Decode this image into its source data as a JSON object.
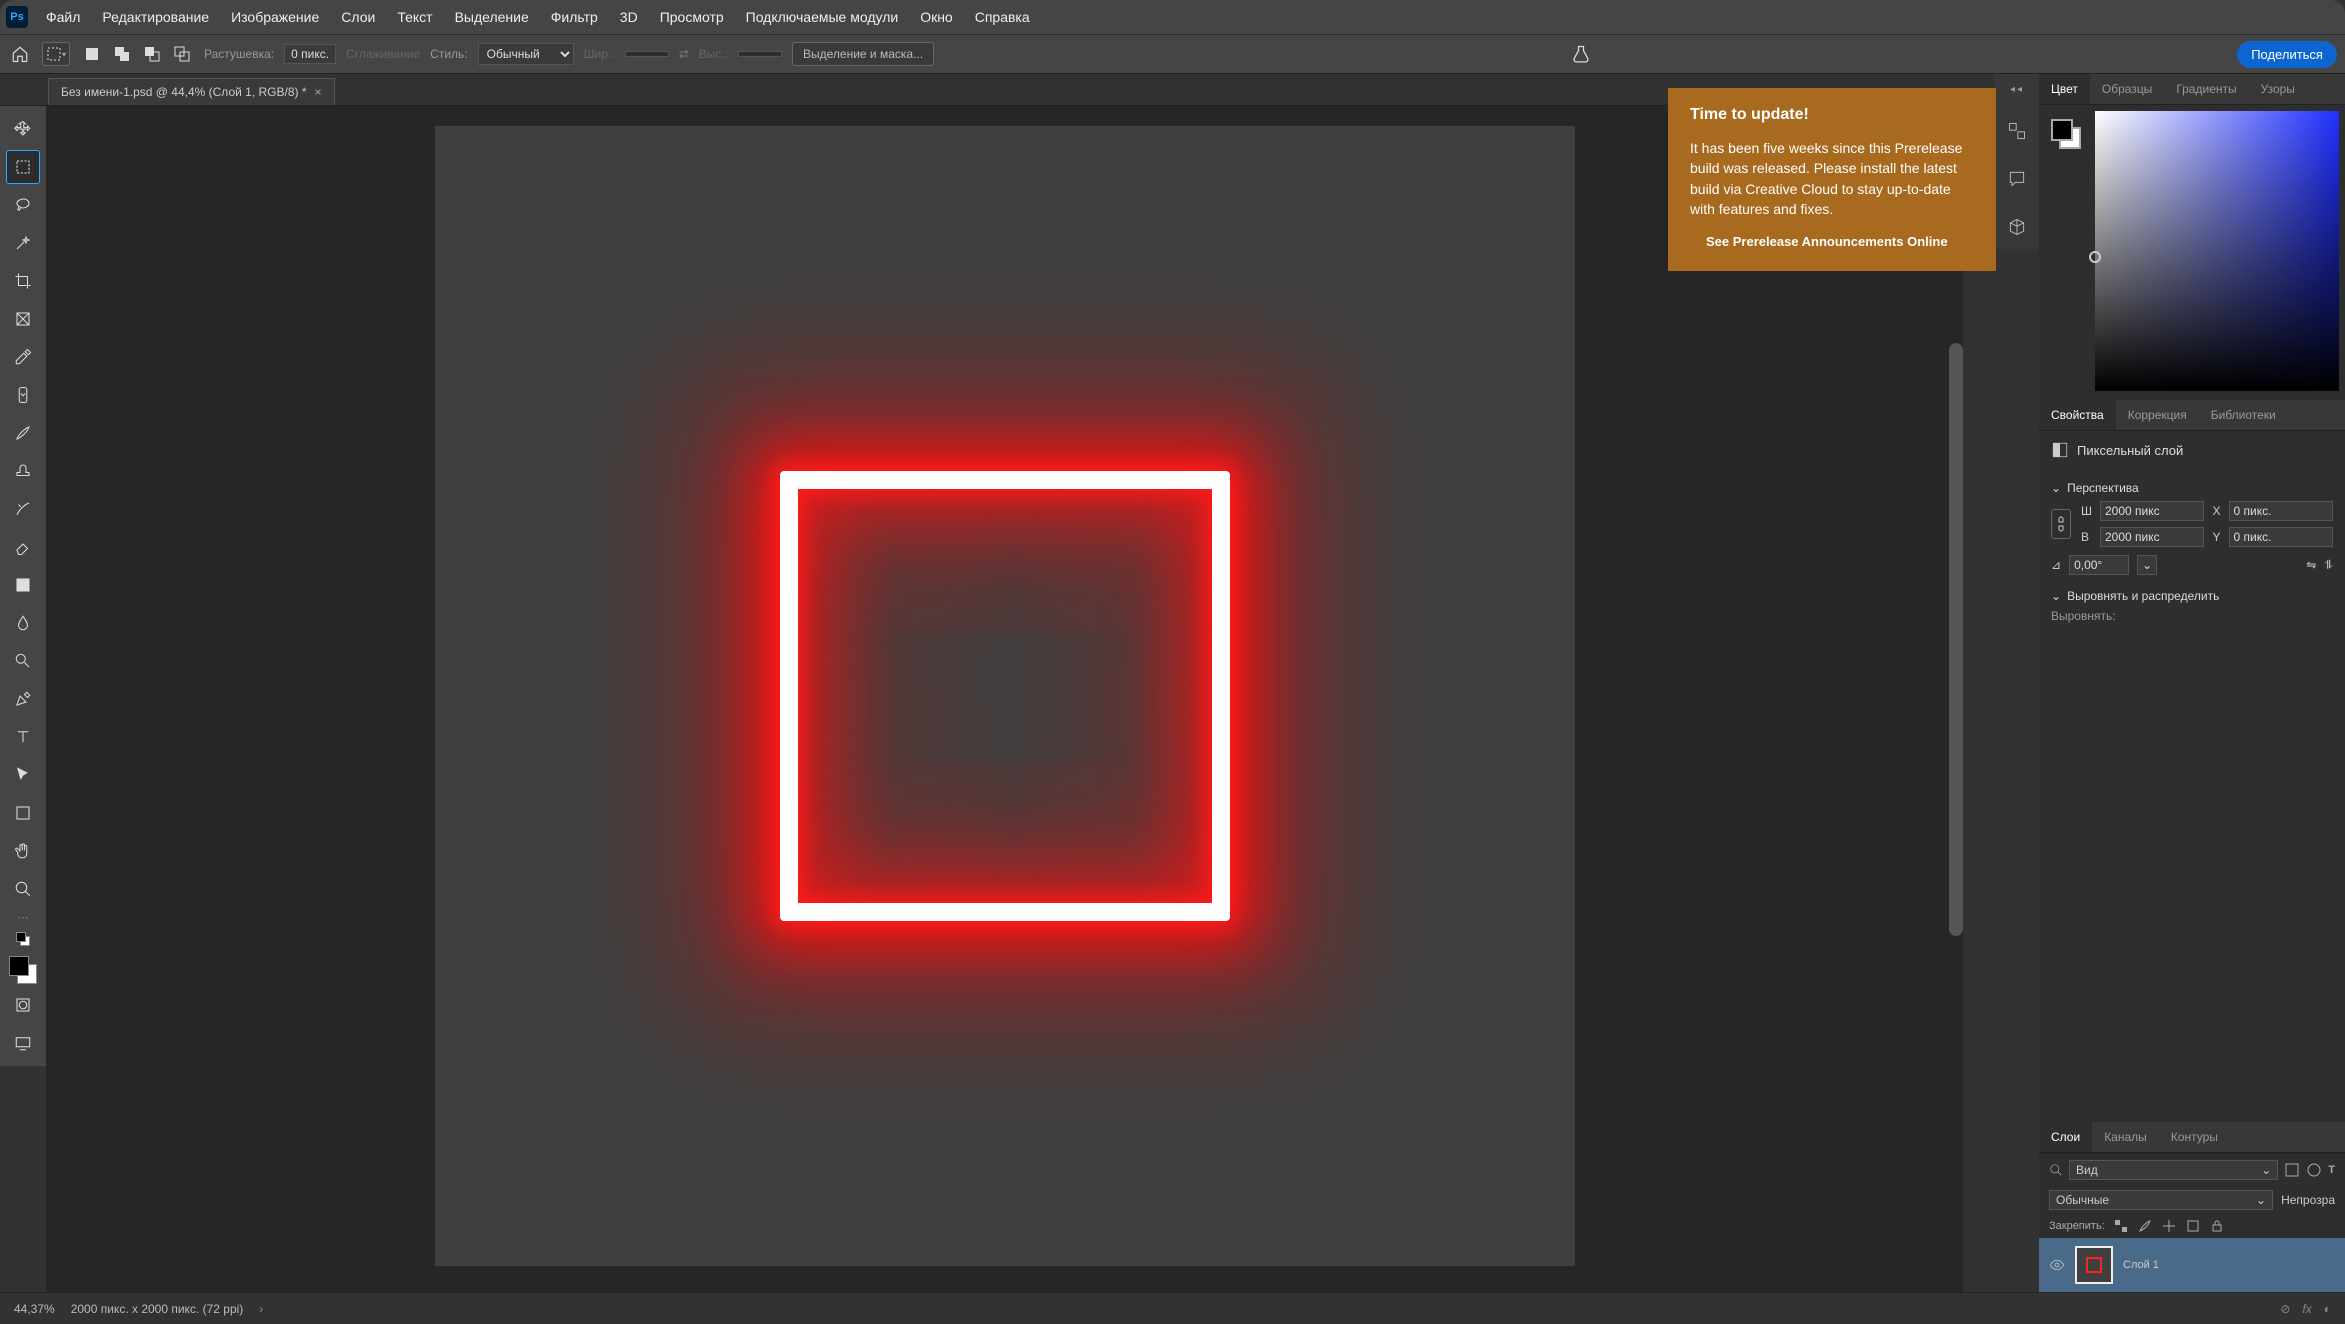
{
  "menu": [
    "Файл",
    "Редактирование",
    "Изображение",
    "Слои",
    "Текст",
    "Выделение",
    "Фильтр",
    "3D",
    "Просмотр",
    "Подключаемые модули",
    "Окно",
    "Справка"
  ],
  "opt": {
    "feather_label": "Растушевка:",
    "feather_value": "0 пикс.",
    "antialias": "Сглаживание",
    "style_label": "Стиль:",
    "style_value": "Обычный",
    "width_label": "Шир.:",
    "width_value": "",
    "height_label": "Выс.:",
    "height_value": "",
    "select_mask": "Выделение и маска...",
    "share": "Поделиться"
  },
  "tab": {
    "title": "Без имени-1.psd @ 44,4% (Слой 1, RGB/8) *"
  },
  "notif": {
    "title": "Time to update!",
    "body": "It has been five weeks since this Prerelease build was released. Please install the latest build via Creative Cloud to stay up-to-date with features and fixes.",
    "link": "See Prerelease Announcements Online"
  },
  "panels": {
    "color_tabs": [
      "Цвет",
      "Образцы",
      "Градиенты",
      "Узоры"
    ],
    "props_tabs": [
      "Свойства",
      "Коррекция",
      "Библиотеки"
    ],
    "props_kind": "Пиксельный слой",
    "transform": "Перспектива",
    "w_label": "Ш",
    "w_value": "2000 пикс",
    "h_label": "В",
    "h_value": "2000 пикс",
    "x_label": "X",
    "x_value": "0 пикс.",
    "y_label": "Y",
    "y_value": "0 пикс.",
    "angle": "0,00°",
    "align_title": "Выровнять и распределить",
    "align_label": "Выровнять:",
    "layers_tabs": [
      "Слои",
      "Каналы",
      "Контуры"
    ],
    "filter_kind": "Вид",
    "blend": "Обычные",
    "opacity_label": "Непрозра",
    "lock_label": "Закрепить:",
    "layer1": "Слой 1"
  },
  "status": {
    "zoom": "44,37%",
    "dims": "2000 пикс. x 2000 пикс. (72 ppi)"
  }
}
